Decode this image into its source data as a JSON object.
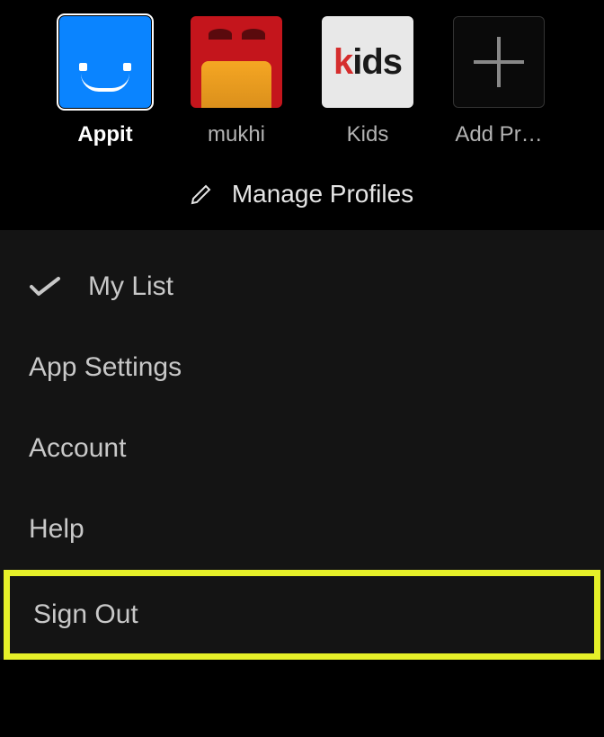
{
  "profiles": {
    "items": [
      {
        "label": "Appit"
      },
      {
        "label": "mukhi"
      },
      {
        "label": "Kids"
      },
      {
        "label": "Add Pr…"
      }
    ],
    "manage_label": "Manage Profiles"
  },
  "menu": {
    "my_list": "My List",
    "app_settings": "App Settings",
    "account": "Account",
    "help": "Help",
    "sign_out": "Sign Out"
  }
}
